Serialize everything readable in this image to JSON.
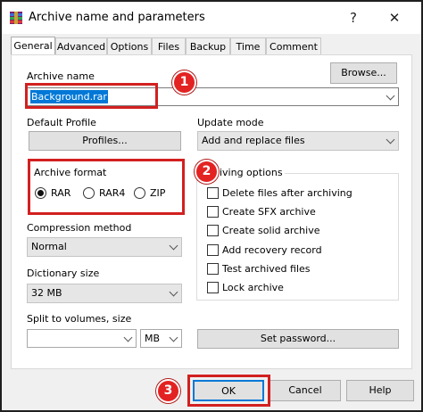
{
  "window": {
    "title": "Archive name and parameters",
    "help_glyph": "?",
    "close_glyph": "✕"
  },
  "tabs": [
    "General",
    "Advanced",
    "Options",
    "Files",
    "Backup",
    "Time",
    "Comment"
  ],
  "archive_name": {
    "label": "Archive name",
    "value": "Background.rar",
    "browse_label": "Browse..."
  },
  "default_profile": {
    "label": "Default Profile",
    "button_label": "Profiles..."
  },
  "update_mode": {
    "label": "Update mode",
    "value": "Add and replace files"
  },
  "archive_format": {
    "label": "Archive format",
    "options": [
      "RAR",
      "RAR4",
      "ZIP"
    ],
    "selected": "RAR"
  },
  "archiving_options": {
    "label": "hiving options",
    "items": [
      {
        "label": "Delete files after archiving",
        "checked": false
      },
      {
        "label": "Create SFX archive",
        "checked": false
      },
      {
        "label": "Create solid archive",
        "checked": false
      },
      {
        "label": "Add recovery record",
        "checked": false
      },
      {
        "label": "Test archived files",
        "checked": false
      },
      {
        "label": "Lock archive",
        "checked": false
      }
    ]
  },
  "compression_method": {
    "label": "Compression method",
    "value": "Normal"
  },
  "dictionary_size": {
    "label": "Dictionary size",
    "value": "32 MB"
  },
  "split_volumes": {
    "label": "Split to volumes, size",
    "value": "",
    "unit": "MB"
  },
  "set_password_label": "Set password...",
  "footer": {
    "ok_label": "OK",
    "cancel_label": "Cancel",
    "help_label": "Help"
  },
  "annotations": [
    "1",
    "2",
    "3"
  ],
  "colors": {
    "highlight_red": "#d22020",
    "badge_red": "#e32222",
    "selection_blue": "#0078d7"
  },
  "icons": {
    "app": "winrar-icon",
    "checkbox": "checkbox-icon",
    "radio": "radio-icon",
    "dropdown": "chevron-down-icon"
  }
}
